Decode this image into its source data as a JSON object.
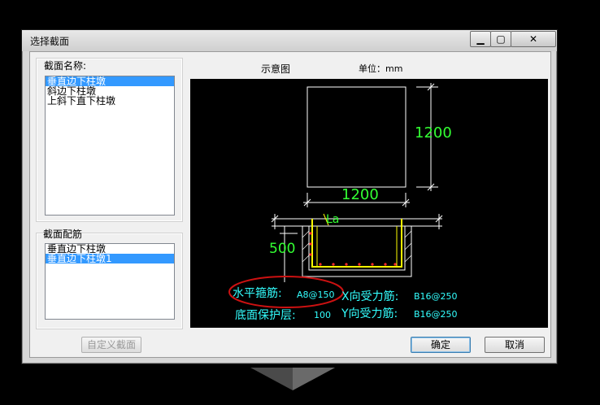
{
  "window": {
    "title": "选择截面"
  },
  "section_names": {
    "label": "截面名称:",
    "items": [
      "垂直边下柱墩",
      "斜边下柱墩",
      "上斜下直下柱墩"
    ],
    "selected": 0
  },
  "section_rebar": {
    "label": "截面配筋",
    "items": [
      "垂直边下柱墩",
      "垂直边下柱墩1"
    ],
    "selected": 1
  },
  "preview": {
    "label": "示意图",
    "unit_label": "单位：mm"
  },
  "drawing": {
    "width_dim": "1200",
    "height_dim": "1200",
    "la_label": "La",
    "depth_dim": "500",
    "horizontal_stirrup_label": "水平箍筋:",
    "horizontal_stirrup_value": "A8@150",
    "x_rebar_label": "X向受力筋:",
    "x_rebar_value": "B16@250",
    "bottom_cover_label": "底面保护层:",
    "bottom_cover_value": "100",
    "y_rebar_label": "Y向受力筋:",
    "y_rebar_value": "B16@250"
  },
  "buttons": {
    "custom": "自定义截面",
    "ok": "确定",
    "cancel": "取消"
  },
  "colors": {
    "drawing_bg": "#000000",
    "dim_green": "#33ff33",
    "label_cyan": "#33ffff",
    "rebar_yellow": "#ffff00",
    "dot_red": "#ff2a2a",
    "highlight_ellipse": "#cc1111",
    "selection": "#3399ff"
  }
}
